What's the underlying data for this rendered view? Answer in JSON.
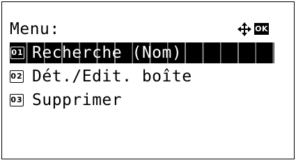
{
  "header": {
    "title": "Menu:",
    "nav_icon": "four-way-arrow-icon",
    "ok_label": "OK"
  },
  "menu": {
    "selected_index": 0,
    "items": [
      {
        "number": "01",
        "label": "Recherche (Nom)"
      },
      {
        "number": "02",
        "label": "Dét./Edit. boîte"
      },
      {
        "number": "03",
        "label": "Supprimer"
      }
    ]
  },
  "colors": {
    "foreground": "#000000",
    "background": "#ffffff",
    "highlight": "#000000"
  }
}
